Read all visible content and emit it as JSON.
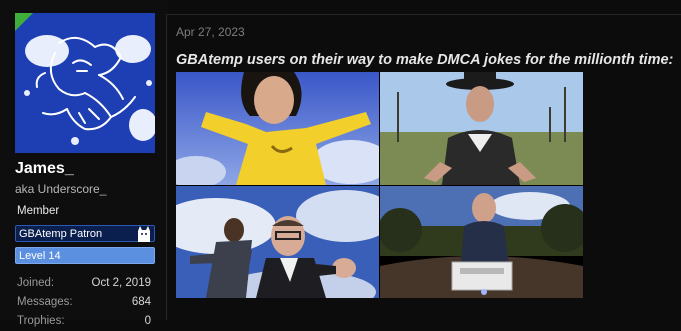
{
  "user": {
    "name": "James_",
    "custom_title": "aka Underscore_",
    "role": "Member",
    "banners": [
      "GBAtemp Patron",
      "Level 14"
    ],
    "stats": [
      {
        "label": "Joined:",
        "value": "Oct 2, 2019"
      },
      {
        "label": "Messages:",
        "value": "684"
      },
      {
        "label": "Trophies:",
        "value": "0"
      }
    ],
    "avatar_bg": "#1e3fb4"
  },
  "post": {
    "date": "Apr 27, 2023",
    "text": "GBAtemp users on their way to make DMCA jokes for the millionth time:"
  },
  "colors": {
    "background": "#0c0c0c",
    "patron_banner": "#0a1f4e",
    "level_banner": "#5b8fe0"
  }
}
